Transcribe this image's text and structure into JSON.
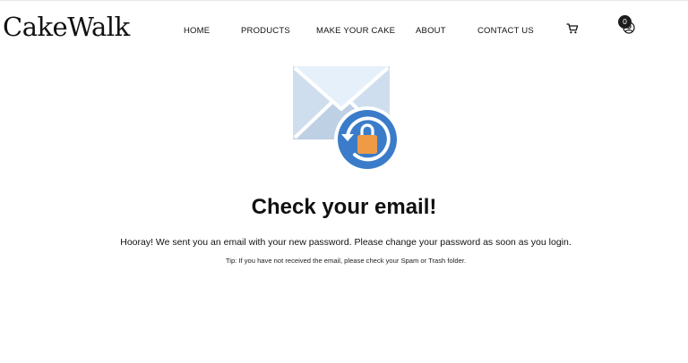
{
  "header": {
    "brand": "CakeWalk",
    "nav": [
      {
        "label": "HOME"
      },
      {
        "label": "PRODUCTS"
      },
      {
        "label": "MAKE YOUR CAKE"
      },
      {
        "label": "ABOUT"
      },
      {
        "label": "CONTACT US"
      }
    ],
    "cart_count": "0",
    "icons": [
      "cart-icon",
      "account-icon"
    ]
  },
  "main": {
    "illustration": "envelope-with-lock-reset-icon",
    "title": "Check your email!",
    "message": "Hooray! We sent you an email with your new password. Please change your password as soon as you login.",
    "tip": "Tip: If you have not received the email, please check your Spam or Trash folder."
  },
  "colors": {
    "envelope_light": "#e6f0fa",
    "envelope_mid": "#cfdeee",
    "envelope_dark": "#bdd0e4",
    "circle_blue": "#3a7cc9",
    "lock_orange": "#ef9b45",
    "text": "#111111"
  }
}
